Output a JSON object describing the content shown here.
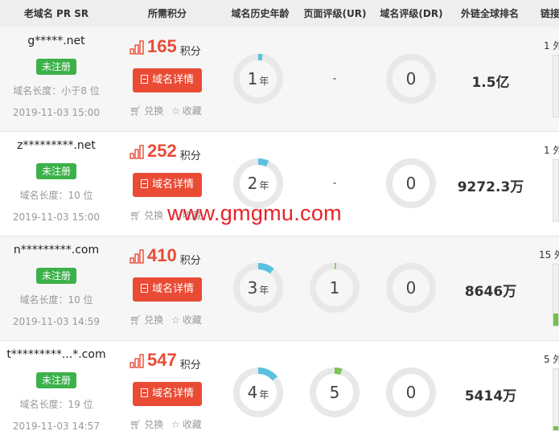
{
  "headers": [
    "老域名 PR SR",
    "所需积分",
    "域名历史年龄",
    "页面评级(UR)",
    "域名评级(DR)",
    "外链全球排名",
    "链接"
  ],
  "labels": {
    "unregistered": "未注册",
    "detail_button": "域名详情",
    "points_unit": "积分",
    "year_unit": "年",
    "exchange": "兑换",
    "favorite": "收藏",
    "link_suffix": "外"
  },
  "watermark": "www.gmgmu.com",
  "rows": [
    {
      "domain": "g*****.net",
      "length": "域名长度：小于8 位",
      "time": "2019-11-03 15:00",
      "points": "165",
      "age": "1",
      "age_fraction": 0.03,
      "ur": "-",
      "ur_fraction": 0,
      "dr": "0",
      "dr_fraction": 0,
      "rank": "1.5亿",
      "links": "1",
      "link_fraction": 0.0
    },
    {
      "domain": "z*********.net",
      "length": "域名长度：10 位",
      "time": "2019-11-03 15:00",
      "points": "252",
      "age": "2",
      "age_fraction": 0.07,
      "ur": "-",
      "ur_fraction": 0,
      "dr": "0",
      "dr_fraction": 0,
      "rank": "9272.3万",
      "links": "1",
      "link_fraction": 0.0
    },
    {
      "domain": "n*********.com",
      "length": "域名长度：10 位",
      "time": "2019-11-03 14:59",
      "points": "410",
      "age": "3",
      "age_fraction": 0.11,
      "ur": "1",
      "ur_fraction": 0.01,
      "dr": "0",
      "dr_fraction": 0,
      "rank": "8646万",
      "links": "15",
      "link_fraction": 0.2
    },
    {
      "domain": "t*********...*.com",
      "length": "域名长度：19 位",
      "time": "2019-11-03 14:57",
      "points": "547",
      "age": "4",
      "age_fraction": 0.14,
      "ur": "5",
      "ur_fraction": 0.05,
      "dr": "0",
      "dr_fraction": 0,
      "rank": "5414万",
      "links": "5",
      "link_fraction": 0.07
    }
  ]
}
